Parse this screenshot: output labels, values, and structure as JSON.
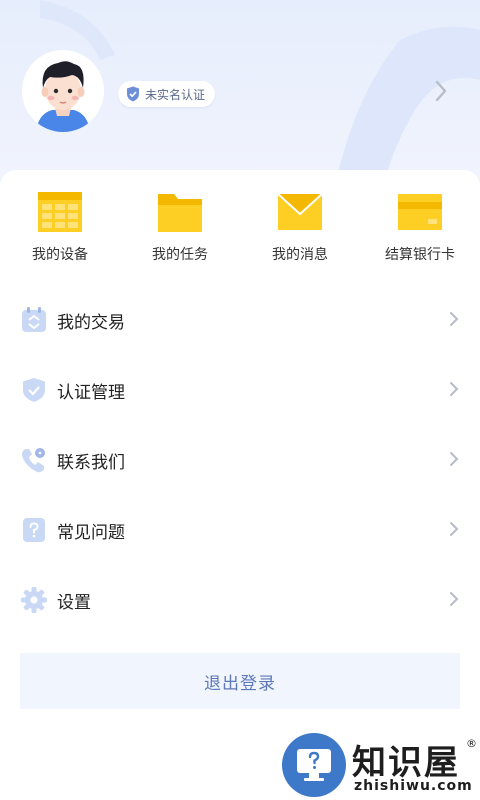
{
  "profile": {
    "badge_text": "未实名认证",
    "icons": {
      "avatar": "avatar-cartoon-boy",
      "badge": "shield-check-icon",
      "arrow": "chevron-right-icon"
    }
  },
  "quick_actions": [
    {
      "label": "我的设备",
      "icon": "device-table-icon"
    },
    {
      "label": "我的任务",
      "icon": "folder-icon"
    },
    {
      "label": "我的消息",
      "icon": "envelope-icon"
    },
    {
      "label": "结算银行卡",
      "icon": "bank-card-icon"
    }
  ],
  "menu": [
    {
      "label": "我的交易",
      "icon": "transaction-icon"
    },
    {
      "label": "认证管理",
      "icon": "shield-check-icon"
    },
    {
      "label": "联系我们",
      "icon": "phone-icon"
    },
    {
      "label": "常见问题",
      "icon": "question-icon"
    },
    {
      "label": "设置",
      "icon": "gear-icon"
    }
  ],
  "logout_label": "退出登录",
  "watermark": {
    "title": "知识屋",
    "registered": "®",
    "subtitle": "zhishiwu.com",
    "icon": "monitor-question-icon"
  },
  "colors": {
    "accent_yellow": "#fdcf24",
    "icon_light_blue": "#c9d8f4",
    "logout_text": "#5d78b8",
    "watermark_blue": "#3e78c8"
  }
}
